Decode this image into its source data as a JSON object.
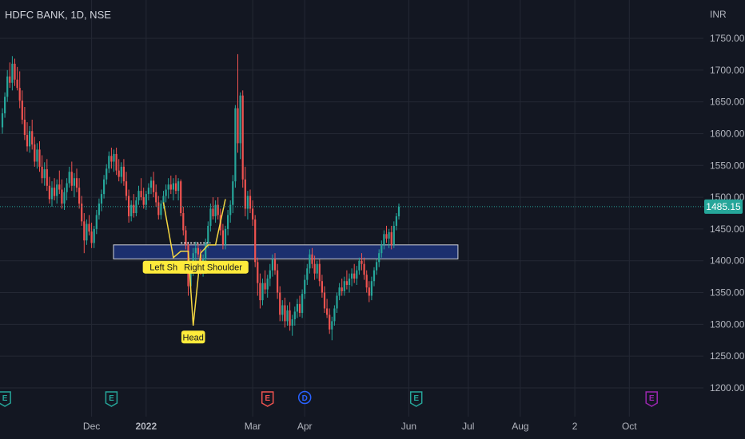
{
  "colors": {
    "background": "#131722",
    "grid": "#242834",
    "up": "#26a69a",
    "down": "#ef5350",
    "zone_fill": "#1c2f6e",
    "zone_border": "#d1d4dc",
    "pattern_line": "#f5d742",
    "pattern_label_bg": "#ffeb3b",
    "price_badge": "#26a69a",
    "earnings": "#26a69a",
    "earnings_negative": "#ef5350",
    "dividend": "#2962ff",
    "future_event": "#9c27b0"
  },
  "header": {
    "title": "HDFC BANK, 1D, NSE"
  },
  "price_axis": {
    "currency": "INR"
  },
  "chart_data": {
    "type": "candlestick",
    "title": "HDFC BANK, 1D, NSE",
    "y_unit": "INR",
    "ylim": [
      1180,
      1790
    ],
    "y_ticks": [
      1200,
      1250,
      1300,
      1350,
      1400,
      1450,
      1500,
      1550,
      1600,
      1650,
      1700,
      1750
    ],
    "y_tick_labels": [
      "1200.00",
      "1250.00",
      "1300.00",
      "1350.00",
      "1400.00",
      "1450.00",
      "1500.00",
      "1550.00",
      "1600.00",
      "1650.00",
      "1700.00",
      "1750.00"
    ],
    "x_labels": [
      {
        "label": "Dec",
        "bar": 36,
        "bold": false
      },
      {
        "label": "2022",
        "bar": 58,
        "bold": true
      },
      {
        "label": "Mar",
        "bar": 101,
        "bold": false
      },
      {
        "label": "Apr",
        "bar": 122,
        "bold": false
      },
      {
        "label": "Jun",
        "bar": 164,
        "bold": false
      },
      {
        "label": "Jul",
        "bar": 188,
        "bold": false
      },
      {
        "label": "Aug",
        "bar": 209,
        "bold": false
      },
      {
        "label": "2",
        "bar": 231,
        "bold": false
      },
      {
        "label": "Oct",
        "bar": 253,
        "bold": false
      }
    ],
    "last_price": 1485.15,
    "last_price_label": "1485.15",
    "grid": true,
    "candles": [
      [
        1610,
        1640,
        1600,
        1632
      ],
      [
        1632,
        1665,
        1625,
        1658
      ],
      [
        1658,
        1700,
        1650,
        1690
      ],
      [
        1690,
        1712,
        1672,
        1680
      ],
      [
        1680,
        1722,
        1668,
        1710
      ],
      [
        1710,
        1718,
        1675,
        1685
      ],
      [
        1685,
        1705,
        1668,
        1672
      ],
      [
        1672,
        1698,
        1640,
        1652
      ],
      [
        1652,
        1668,
        1615,
        1622
      ],
      [
        1622,
        1642,
        1590,
        1598
      ],
      [
        1598,
        1618,
        1572,
        1580
      ],
      [
        1580,
        1612,
        1570,
        1604
      ],
      [
        1604,
        1622,
        1575,
        1583
      ],
      [
        1583,
        1595,
        1548,
        1556
      ],
      [
        1556,
        1585,
        1545,
        1575
      ],
      [
        1575,
        1588,
        1540,
        1548
      ],
      [
        1548,
        1566,
        1522,
        1530
      ],
      [
        1530,
        1555,
        1518,
        1544
      ],
      [
        1544,
        1560,
        1510,
        1518
      ],
      [
        1518,
        1532,
        1490,
        1497
      ],
      [
        1497,
        1525,
        1485,
        1515
      ],
      [
        1515,
        1530,
        1495,
        1502
      ],
      [
        1502,
        1528,
        1490,
        1520
      ],
      [
        1520,
        1542,
        1505,
        1512
      ],
      [
        1512,
        1528,
        1482,
        1490
      ],
      [
        1490,
        1515,
        1480,
        1508
      ],
      [
        1508,
        1530,
        1495,
        1522
      ],
      [
        1522,
        1548,
        1515,
        1540
      ],
      [
        1540,
        1556,
        1510,
        1518
      ],
      [
        1518,
        1538,
        1500,
        1530
      ],
      [
        1530,
        1545,
        1508,
        1515
      ],
      [
        1515,
        1530,
        1482,
        1490
      ],
      [
        1490,
        1502,
        1455,
        1462
      ],
      [
        1462,
        1475,
        1412,
        1432
      ],
      [
        1432,
        1465,
        1425,
        1458
      ],
      [
        1458,
        1472,
        1440,
        1446
      ],
      [
        1446,
        1460,
        1420,
        1428
      ],
      [
        1428,
        1455,
        1420,
        1450
      ],
      [
        1450,
        1480,
        1442,
        1472
      ],
      [
        1472,
        1498,
        1465,
        1490
      ],
      [
        1490,
        1512,
        1478,
        1505
      ],
      [
        1505,
        1535,
        1498,
        1528
      ],
      [
        1528,
        1552,
        1520,
        1545
      ],
      [
        1545,
        1572,
        1538,
        1565
      ],
      [
        1565,
        1578,
        1545,
        1556
      ],
      [
        1556,
        1575,
        1540,
        1568
      ],
      [
        1568,
        1578,
        1535,
        1542
      ],
      [
        1542,
        1560,
        1525,
        1532
      ],
      [
        1532,
        1555,
        1522,
        1548
      ],
      [
        1548,
        1560,
        1518,
        1525
      ],
      [
        1525,
        1540,
        1495,
        1502
      ],
      [
        1502,
        1512,
        1460,
        1470
      ],
      [
        1470,
        1495,
        1462,
        1488
      ],
      [
        1488,
        1505,
        1468,
        1475
      ],
      [
        1475,
        1500,
        1470,
        1495
      ],
      [
        1495,
        1518,
        1488,
        1510
      ],
      [
        1510,
        1530,
        1495,
        1500
      ],
      [
        1500,
        1515,
        1482,
        1488
      ],
      [
        1488,
        1510,
        1480,
        1505
      ],
      [
        1505,
        1522,
        1495,
        1515
      ],
      [
        1515,
        1532,
        1505,
        1526
      ],
      [
        1526,
        1540,
        1500,
        1508
      ],
      [
        1508,
        1520,
        1485,
        1492
      ],
      [
        1492,
        1502,
        1465,
        1472
      ],
      [
        1472,
        1495,
        1465,
        1490
      ],
      [
        1490,
        1510,
        1482,
        1502
      ],
      [
        1502,
        1520,
        1492,
        1512
      ],
      [
        1512,
        1530,
        1498,
        1520
      ],
      [
        1520,
        1534,
        1505,
        1512
      ],
      [
        1512,
        1530,
        1495,
        1522
      ],
      [
        1522,
        1535,
        1505,
        1510
      ],
      [
        1510,
        1530,
        1495,
        1525
      ],
      [
        1525,
        1528,
        1470,
        1475
      ],
      [
        1475,
        1485,
        1440,
        1448
      ],
      [
        1448,
        1455,
        1418,
        1425
      ],
      [
        1425,
        1430,
        1345,
        1360
      ],
      [
        1360,
        1395,
        1350,
        1385
      ],
      [
        1385,
        1420,
        1376,
        1412
      ],
      [
        1412,
        1430,
        1400,
        1420
      ],
      [
        1420,
        1428,
        1405,
        1410
      ],
      [
        1410,
        1418,
        1378,
        1385
      ],
      [
        1385,
        1410,
        1375,
        1402
      ],
      [
        1402,
        1435,
        1395,
        1428
      ],
      [
        1428,
        1462,
        1420,
        1455
      ],
      [
        1455,
        1490,
        1446,
        1482
      ],
      [
        1482,
        1500,
        1465,
        1470
      ],
      [
        1470,
        1495,
        1460,
        1488
      ],
      [
        1488,
        1500,
        1465,
        1472
      ],
      [
        1472,
        1482,
        1440,
        1448
      ],
      [
        1448,
        1458,
        1418,
        1425
      ],
      [
        1425,
        1455,
        1418,
        1450
      ],
      [
        1450,
        1480,
        1440,
        1472
      ],
      [
        1472,
        1495,
        1460,
        1488
      ],
      [
        1488,
        1535,
        1475,
        1525
      ],
      [
        1525,
        1645,
        1515,
        1640
      ],
      [
        1640,
        1725,
        1570,
        1585
      ],
      [
        1585,
        1665,
        1560,
        1660
      ],
      [
        1660,
        1668,
        1515,
        1528
      ],
      [
        1528,
        1548,
        1470,
        1482
      ],
      [
        1482,
        1510,
        1465,
        1502
      ],
      [
        1502,
        1512,
        1475,
        1482
      ],
      [
        1482,
        1495,
        1455,
        1465
      ],
      [
        1465,
        1472,
        1390,
        1398
      ],
      [
        1398,
        1405,
        1345,
        1365
      ],
      [
        1365,
        1380,
        1325,
        1338
      ],
      [
        1338,
        1372,
        1330,
        1365
      ],
      [
        1365,
        1385,
        1348,
        1355
      ],
      [
        1355,
        1378,
        1342,
        1372
      ],
      [
        1372,
        1395,
        1360,
        1385
      ],
      [
        1385,
        1410,
        1375,
        1402
      ],
      [
        1402,
        1412,
        1378,
        1385
      ],
      [
        1385,
        1395,
        1340,
        1350
      ],
      [
        1350,
        1360,
        1305,
        1315
      ],
      [
        1315,
        1338,
        1305,
        1330
      ],
      [
        1330,
        1342,
        1295,
        1305
      ],
      [
        1305,
        1330,
        1298,
        1322
      ],
      [
        1322,
        1335,
        1290,
        1298
      ],
      [
        1298,
        1315,
        1282,
        1308
      ],
      [
        1308,
        1328,
        1298,
        1320
      ],
      [
        1320,
        1340,
        1310,
        1332
      ],
      [
        1332,
        1345,
        1312,
        1318
      ],
      [
        1318,
        1355,
        1310,
        1348
      ],
      [
        1348,
        1378,
        1340,
        1370
      ],
      [
        1370,
        1395,
        1362,
        1388
      ],
      [
        1388,
        1418,
        1380,
        1410
      ],
      [
        1410,
        1420,
        1388,
        1395
      ],
      [
        1395,
        1408,
        1370,
        1380
      ],
      [
        1380,
        1400,
        1372,
        1395
      ],
      [
        1395,
        1402,
        1360,
        1368
      ],
      [
        1368,
        1378,
        1342,
        1350
      ],
      [
        1350,
        1360,
        1318,
        1325
      ],
      [
        1325,
        1340,
        1310,
        1315
      ],
      [
        1315,
        1325,
        1285,
        1292
      ],
      [
        1292,
        1312,
        1275,
        1305
      ],
      [
        1305,
        1330,
        1298,
        1325
      ],
      [
        1325,
        1350,
        1318,
        1345
      ],
      [
        1345,
        1365,
        1338,
        1358
      ],
      [
        1358,
        1372,
        1345,
        1352
      ],
      [
        1352,
        1375,
        1345,
        1368
      ],
      [
        1368,
        1385,
        1355,
        1362
      ],
      [
        1362,
        1380,
        1350,
        1372
      ],
      [
        1372,
        1388,
        1360,
        1380
      ],
      [
        1380,
        1395,
        1365,
        1372
      ],
      [
        1372,
        1392,
        1362,
        1385
      ],
      [
        1385,
        1405,
        1378,
        1400
      ],
      [
        1400,
        1412,
        1385,
        1395
      ],
      [
        1395,
        1405,
        1370,
        1378
      ],
      [
        1378,
        1385,
        1350,
        1358
      ],
      [
        1358,
        1368,
        1335,
        1345
      ],
      [
        1345,
        1375,
        1338,
        1368
      ],
      [
        1368,
        1390,
        1360,
        1385
      ],
      [
        1385,
        1402,
        1378,
        1398
      ],
      [
        1398,
        1418,
        1390,
        1412
      ],
      [
        1412,
        1432,
        1405,
        1425
      ],
      [
        1425,
        1448,
        1418,
        1442
      ],
      [
        1442,
        1455,
        1428,
        1435
      ],
      [
        1435,
        1450,
        1420,
        1445
      ],
      [
        1445,
        1455,
        1418,
        1425
      ],
      [
        1425,
        1462,
        1420,
        1455
      ],
      [
        1455,
        1475,
        1448,
        1470
      ],
      [
        1470,
        1490,
        1465,
        1485
      ]
    ],
    "zone": {
      "label": "",
      "from_bar": 30,
      "to_bar": 139,
      "y_low": 1403,
      "y_high": 1425
    },
    "pattern": {
      "name": "Head and Shoulders",
      "points": [
        [
          65,
          1492
        ],
        [
          69,
          1405
        ],
        [
          72,
          1415
        ],
        [
          75,
          1415
        ],
        [
          77,
          1298
        ],
        [
          80,
          1412
        ],
        [
          83,
          1425
        ],
        [
          86,
          1425
        ],
        [
          90,
          1497
        ]
      ],
      "neckline": {
        "from_bar": 72,
        "to_bar": 84,
        "y": 1428
      },
      "labels": [
        {
          "text": "Left Shoulder",
          "bar": 70,
          "y": 1390
        },
        {
          "text": "Right Shoulder",
          "bar": 85,
          "y": 1390
        },
        {
          "text": "Head",
          "bar": 77,
          "y": 1280
        }
      ]
    },
    "events": [
      {
        "type": "earnings",
        "letter": "E",
        "bar": 1
      },
      {
        "type": "earnings",
        "letter": "E",
        "bar": 44
      },
      {
        "type": "earnings_negative",
        "letter": "E",
        "bar": 107
      },
      {
        "type": "dividend",
        "letter": "D",
        "bar": 122
      },
      {
        "type": "earnings",
        "letter": "E",
        "bar": 167
      },
      {
        "type": "future_event",
        "letter": "E",
        "bar": 262
      }
    ]
  }
}
